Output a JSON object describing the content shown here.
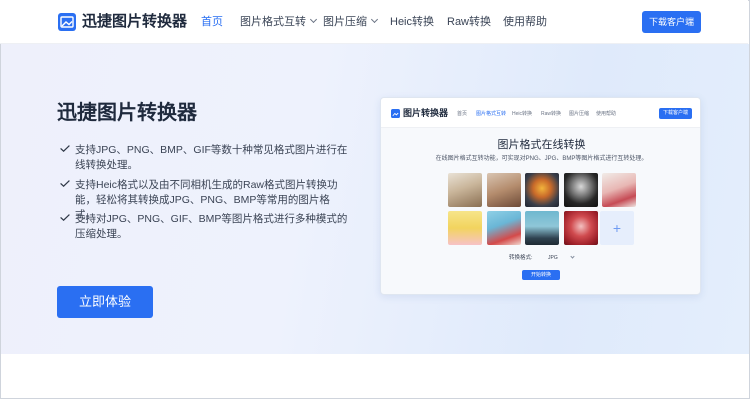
{
  "header": {
    "logo_text": "迅捷图片转换器",
    "nav": [
      {
        "label": "首页",
        "active": true,
        "dropdown": false
      },
      {
        "label": "图片格式互转",
        "active": false,
        "dropdown": true
      },
      {
        "label": "图片压缩",
        "active": false,
        "dropdown": true
      },
      {
        "label": "Heic转换",
        "active": false,
        "dropdown": false
      },
      {
        "label": "Raw转换",
        "active": false,
        "dropdown": false
      },
      {
        "label": "使用帮助",
        "active": false,
        "dropdown": false
      }
    ],
    "download_label": "下载客户端"
  },
  "hero": {
    "title": "迅捷图片转换器",
    "features": [
      "支持JPG、PNG、BMP、GIF等数十种常见格式图片进行在线转换处理。",
      "支持Heic格式以及由不同相机生成的Raw格式图片转换功能，轻松将其转换成JPG、PNG、BMP等常用的图片格式。",
      "支持对JPG、PNG、GIF、BMP等图片格式进行多种模式的压缩处理。"
    ],
    "cta_label": "立即体验"
  },
  "preview": {
    "logo_text": "图片转换器",
    "nav": [
      "首页",
      "图片格式互转",
      "Heic转换",
      "Raw转换",
      "图片压缩",
      "使用帮助"
    ],
    "nav_active_index": 1,
    "download_label": "下载客户端",
    "title": "图片格式在线转换",
    "subtitle": "在线图片格式互转功能，可实现对PNG、JPG、BMP等图片格式进行互转处理。",
    "thumbnail_count": 10,
    "add_icon": "+",
    "format_label": "转换格式:",
    "format_value": "JPG",
    "start_label": "开始转换"
  },
  "colors": {
    "accent": "#2a6ff2",
    "text_dark": "#1f2a3d"
  }
}
